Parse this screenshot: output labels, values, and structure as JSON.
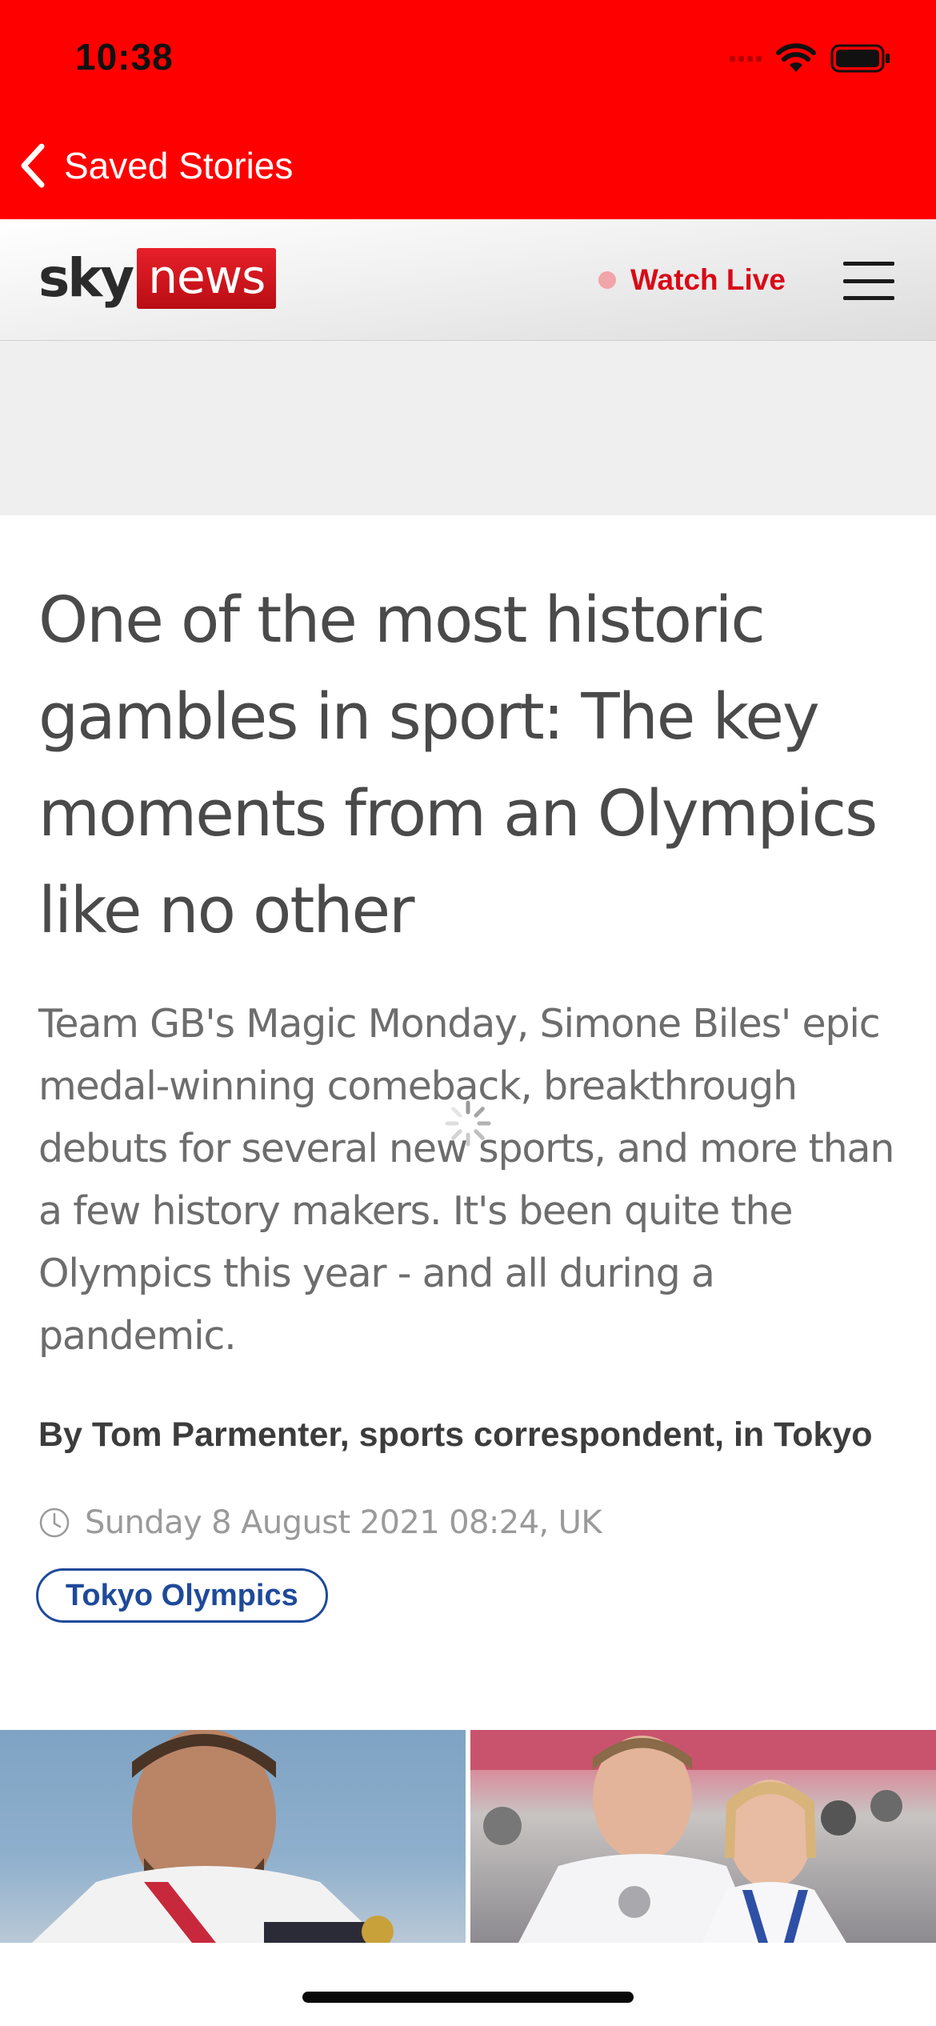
{
  "status_bar": {
    "time": "10:38"
  },
  "nav": {
    "back_label": "Saved Stories"
  },
  "header": {
    "logo_sky": "sky",
    "logo_news": "news",
    "watch_live": "Watch Live"
  },
  "article": {
    "headline": "One of the most historic gambles in sport: The key moments from an Olympics like no other",
    "standfirst": "Team GB's Magic Monday, Simone Biles' epic medal-winning comeback, breakthrough debuts for several new sports, and more than a few history makers. It's been quite the Olympics this year - and all during a pandemic.",
    "byline": "By Tom Parmenter, sports correspondent, in Tokyo",
    "timestamp": "Sunday 8 August 2021 08:24, UK",
    "tag": "Tokyo Olympics"
  },
  "colors": {
    "brand_red": "#ff0000",
    "live_red": "#d80a17",
    "tag_blue": "#1f4a9a"
  },
  "icons": [
    "back-chevron-icon",
    "signal-icon",
    "wifi-icon",
    "battery-icon",
    "menu-icon",
    "clock-icon",
    "loading-spinner-icon"
  ]
}
